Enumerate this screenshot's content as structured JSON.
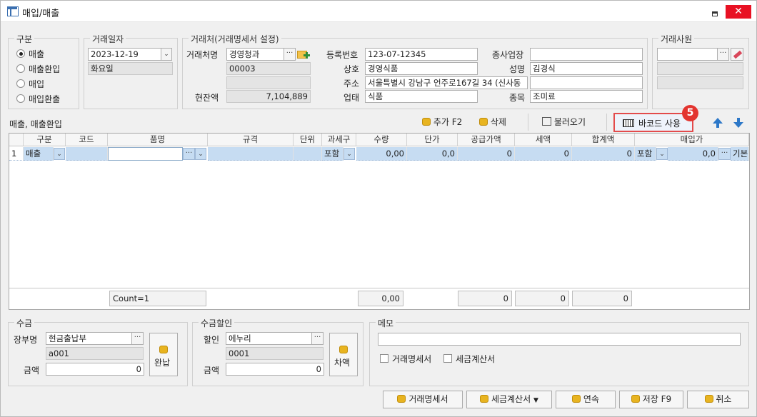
{
  "window": {
    "title": "매입/매출"
  },
  "type_group": {
    "title": "구분",
    "options": [
      "매출",
      "매출환입",
      "매입",
      "매입환출"
    ],
    "selected": 0
  },
  "date_group": {
    "title": "거래일자",
    "date": "2023-12-19",
    "weekday": "화요일"
  },
  "partner_group": {
    "title": "거래처(거래명세서 설정)",
    "name_label": "거래처명",
    "name": "경영청과",
    "code": "00003",
    "balance_label": "현잔액",
    "balance": "7,104,889",
    "regno_label": "등록번호",
    "regno": "123-07-12345",
    "company_label": "상호",
    "company": "경영식품",
    "address_label": "주소",
    "address": "서울특별시 강남구 언주로167길 34 (신사동",
    "business_label": "업태",
    "business": "식품",
    "branch_label": "종사업장",
    "branch": "",
    "owner_label": "성명",
    "owner": "김경식",
    "item_label": "종목",
    "item": "조미료"
  },
  "staff_group": {
    "title": "거래사원",
    "value": ""
  },
  "toolbar": {
    "section_label": "매출, 매출환입",
    "add_label": "추가 F2",
    "delete_label": "삭제",
    "load_label": "불러오기",
    "barcode_label": "바코드 사용",
    "badge": "5"
  },
  "grid": {
    "headers": [
      "구분",
      "코드",
      "품명",
      "규격",
      "단위",
      "과세구",
      "수량",
      "단가",
      "공급가액",
      "세액",
      "합계액",
      "매입가"
    ],
    "row": {
      "index": "1",
      "type": "매출",
      "code": "",
      "name": "",
      "spec": "",
      "unit": "",
      "tax": "포함",
      "qty": "0,00",
      "price": "0,0",
      "supply": "0",
      "vat": "0",
      "total": "0",
      "tax2": "포함",
      "cost": "0,0",
      "extra": "기본"
    },
    "footer": {
      "count": "Count=1",
      "qty": "0,00",
      "supply": "0",
      "vat": "0",
      "total": "0"
    }
  },
  "receipt_group": {
    "title": "수금",
    "ledger_label": "장부명",
    "ledger": "현금출납부",
    "ledger_code": "a001",
    "amount_label": "금액",
    "amount": "0",
    "complete_label": "완납"
  },
  "discount_group": {
    "title": "수금할인",
    "label": "할인",
    "value": "에누리",
    "code": "0001",
    "amount_label": "금액",
    "amount": "0",
    "diff_label": "차액"
  },
  "memo_group": {
    "title": "메모",
    "value": "",
    "check1": "거래명세서",
    "check2": "세금계산서"
  },
  "bottom_buttons": {
    "statement": "거래명세서",
    "invoice": "세금계산서",
    "continue": "연속",
    "save": "저장 F9",
    "cancel": "취소"
  }
}
